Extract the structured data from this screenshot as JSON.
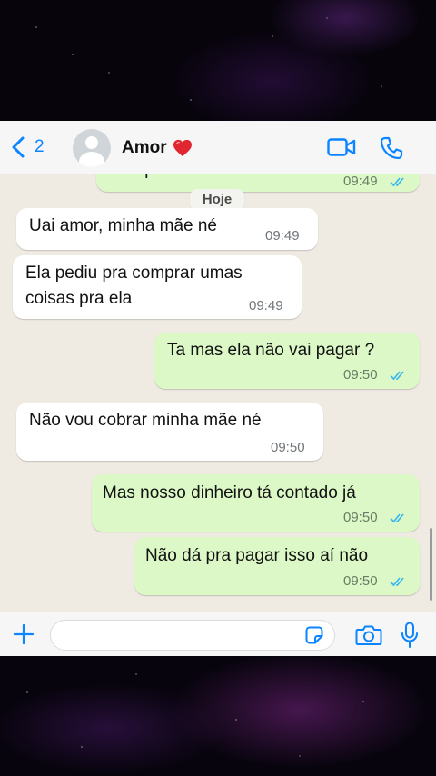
{
  "header": {
    "back_count": "2",
    "contact_name": "Amor",
    "accent": "#0a84ff"
  },
  "chat": {
    "date_separator": "Hoje",
    "messages": [
      {
        "dir": "out",
        "text": "Por que ? Não entendi",
        "time": "09:49",
        "read": true
      },
      {
        "dir": "in",
        "text": "Uai amor, minha mãe né",
        "time": "09:49"
      },
      {
        "dir": "in",
        "lines": [
          "Ela pediu pra comprar umas",
          "coisas pra ela"
        ],
        "time": "09:49"
      },
      {
        "dir": "out",
        "text": "Ta mas ela não vai pagar ?",
        "time": "09:50",
        "read": true
      },
      {
        "dir": "in",
        "text": "Não vou cobrar minha mãe né",
        "time": "09:50"
      },
      {
        "dir": "out",
        "text": "Mas nosso dinheiro tá contado já",
        "time": "09:50",
        "read": true
      },
      {
        "dir": "out",
        "text": "Não dá pra pagar isso aí não",
        "time": "09:50",
        "read": true
      }
    ],
    "colors": {
      "background": "#efeae2",
      "incoming": "#ffffff",
      "outgoing": "#dcf8c6",
      "read_ticks": "#34b7f1"
    }
  },
  "composer": {
    "value": "",
    "placeholder": ""
  },
  "icons": {
    "back": "chevron-left-icon",
    "avatar": "default-avatar-icon",
    "heart": "red-heart-emoji",
    "video": "video-camera-icon",
    "phone": "phone-icon",
    "plus": "plus-icon",
    "sticker": "sticker-icon",
    "camera": "camera-icon",
    "mic": "microphone-icon"
  }
}
